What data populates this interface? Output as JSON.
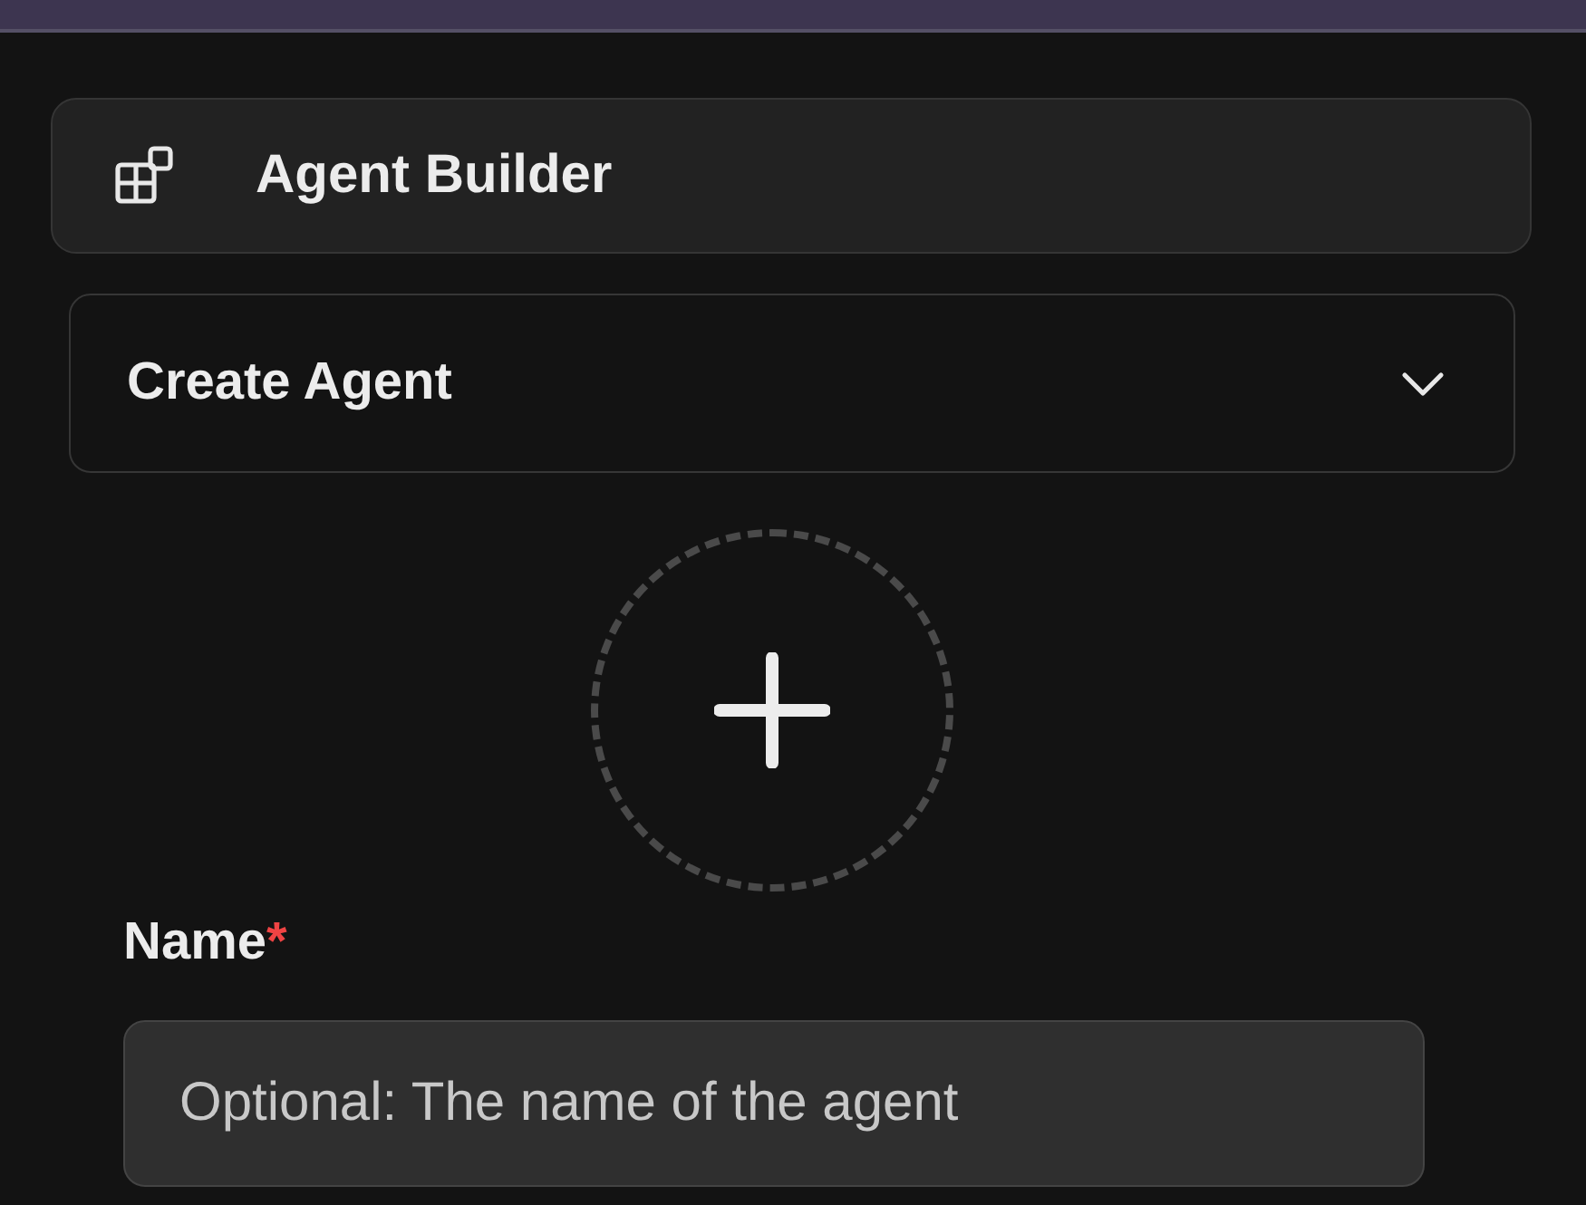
{
  "header": {
    "title": "Agent Builder"
  },
  "mode_select": {
    "value": "Create Agent"
  },
  "avatar_upload": {
    "kind": "add"
  },
  "name_field": {
    "label": "Name",
    "required_mark": "*",
    "placeholder": "Optional: The name of the agent"
  }
}
